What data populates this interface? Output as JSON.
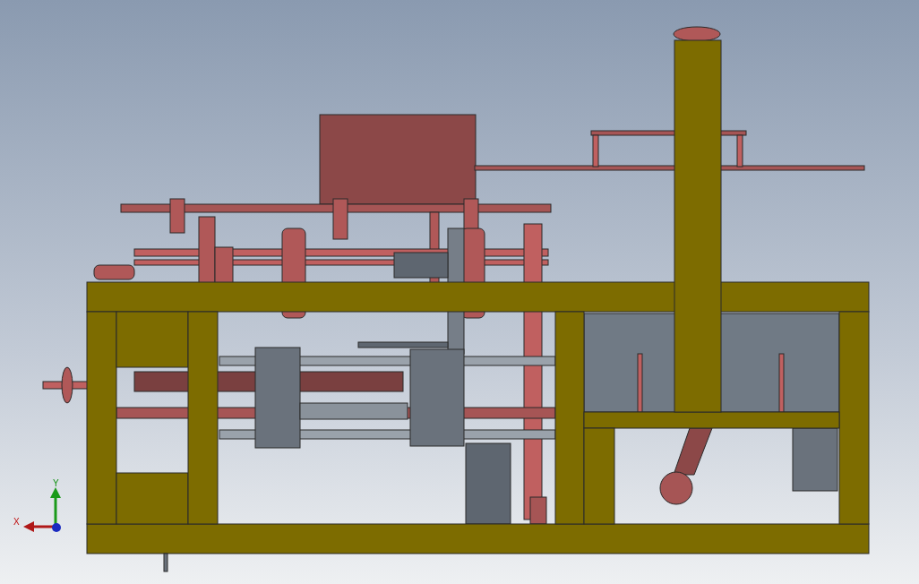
{
  "viewport": {
    "triad": {
      "y_label": "Y",
      "x_label": "X"
    }
  }
}
